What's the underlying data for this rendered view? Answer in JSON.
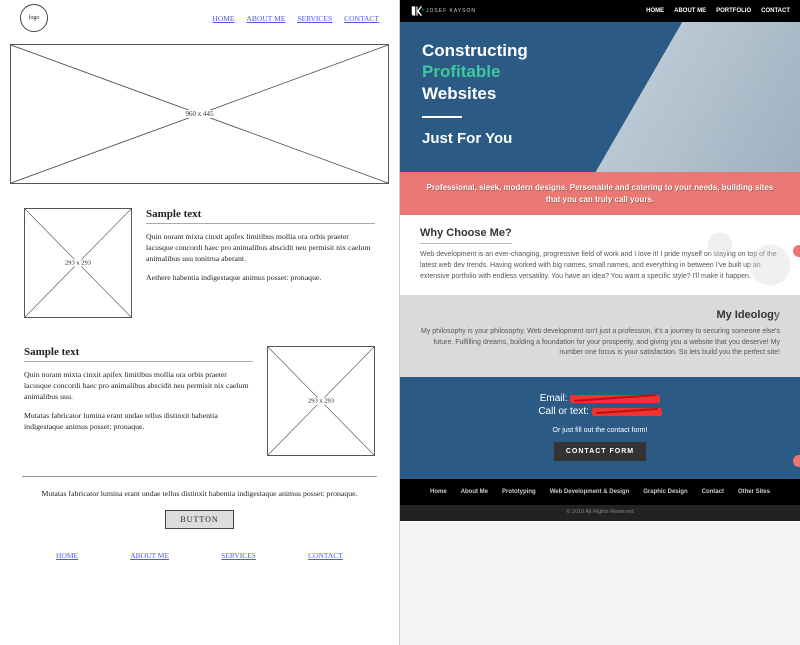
{
  "wireframe": {
    "logo_label": "logo",
    "nav": [
      "HOME",
      "ABOUT ME",
      "SERVICES",
      "CONTACT"
    ],
    "hero_dim": "960 x 445",
    "box_dim": "293 x 293",
    "section1": {
      "heading": "Sample text",
      "p1": "Quin norant mixta cinxit apifex limitibus mollia ora orbis praeter lacusque concordi haec pro animalibus abscidit neu permisit nix caelum animalibus usu tonitrua aberant.",
      "p2": "Aethere habentia indigestaque animus posset: pronaque."
    },
    "section2": {
      "heading": "Sample text",
      "p1": "Quin norant mixta cinxit apifex limitibus mollia ora orbis praeter lacusque concordi haec pro animalibus abscidit neu permisit nix caelum animalibus usu.",
      "p2": "Mutatas fabricator lumina erant undae tellus distinxit habentia indigestaque animus posset: pronaque."
    },
    "cta_text": "Mutatas fabricator lumina erant undae tellus distinxit habentia indigestaque animus posset: pronaque.",
    "button_label": "BUTTON",
    "footer_nav": [
      "HOME",
      "ABOUT ME",
      "SERVICES",
      "CONTACT"
    ]
  },
  "site": {
    "brand_sub": "JOSEF KAYSON",
    "nav": [
      "HOME",
      "ABOUT ME",
      "PORTFOLIO",
      "CONTACT"
    ],
    "hero": {
      "line1": "Constructing",
      "line2_accent": "Profitable",
      "line3": "Websites",
      "sub": "Just For You"
    },
    "banner": "Professional, sleek, modern designs. Personable and catering to your needs, building sites that you can truly call yours.",
    "why": {
      "heading": "Why Choose Me?",
      "body": "Web development is an ever-changing, progressive field of work and I love it! I pride myself on staying on top of the latest web dev trends. Having worked with big names, small names, and everything in between I've built up an extensive portfolio with endless versatility. You have an idea? You want a specific style? I'll make it happen."
    },
    "ideology": {
      "heading": "My Ideology",
      "body": "My philosophy is your philosophy. Web development isn't just a profession, it's a journey to securing someone else's future. Fulfilling dreams, building a foundation for your prosperity, and giving you a website that you deserve! My number one focus is your satisfaction. So lets build you the perfect site!"
    },
    "contact": {
      "email_label": "Email:",
      "call_label": "Call or text:",
      "sub": "Or just fill out the contact form!",
      "button": "CONTACT FORM"
    },
    "footer_nav": [
      "Home",
      "About Me",
      "Prototyping",
      "Web Development & Design",
      "Graphic Design",
      "Contact",
      "Other Sites"
    ],
    "copyright": "© 2016 All Rights Reserved"
  }
}
